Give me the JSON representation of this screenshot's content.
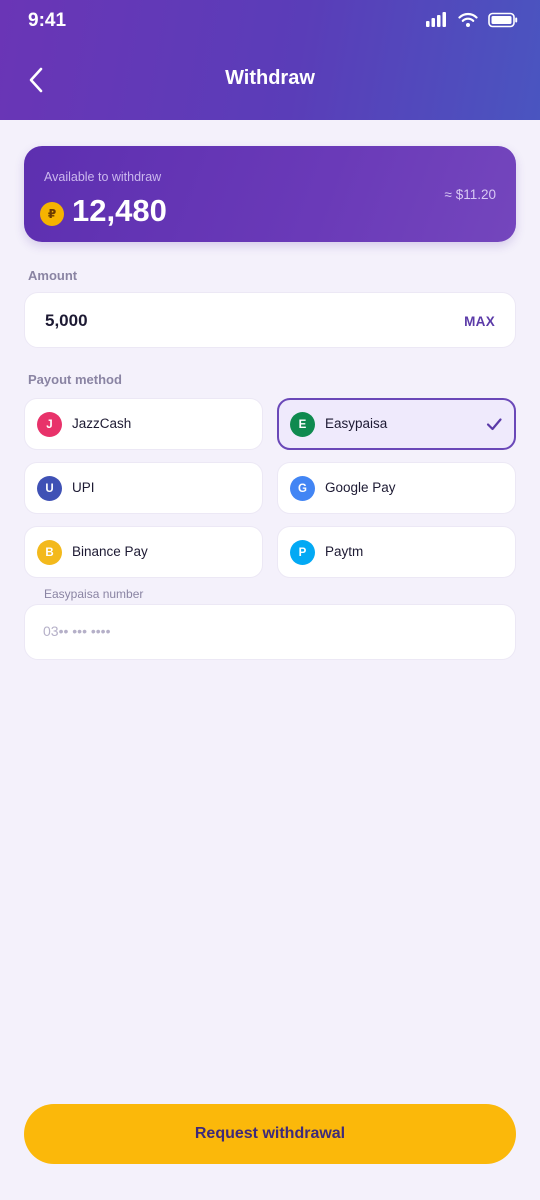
{
  "status_bar": {
    "time": "9:41"
  },
  "header": {
    "title": "Withdraw"
  },
  "balance": {
    "label": "Available to withdraw",
    "coin_symbol": "₽",
    "value": "12,480",
    "usd_equivalent": "≈ $11.20"
  },
  "amount": {
    "label": "Amount",
    "value": "5,000",
    "max_label": "MAX"
  },
  "payout": {
    "label": "Payout method",
    "selected": "Easypaisa",
    "methods": [
      {
        "initial": "J",
        "name": "JazzCash",
        "color": "#e8326a"
      },
      {
        "initial": "E",
        "name": "Easypaisa",
        "color": "#0f8a4f"
      },
      {
        "initial": "U",
        "name": "UPI",
        "color": "#3f51b5"
      },
      {
        "initial": "G",
        "name": "Google Pay",
        "color": "#4285f4"
      },
      {
        "initial": "B",
        "name": "Binance Pay",
        "color": "#f3b91c"
      },
      {
        "initial": "P",
        "name": "Paytm",
        "color": "#03a9f4"
      }
    ]
  },
  "number_field": {
    "label": "Easypaisa number",
    "placeholder": "03•• ••• ••••"
  },
  "cta": {
    "label": "Request withdrawal"
  },
  "colors": {
    "accent": "#5b3aa8",
    "cta": "#fbb80a",
    "background": "#f4f1fb"
  },
  "icons": [
    "signal-icon",
    "wifi-icon",
    "battery-icon",
    "back-chevron-icon",
    "coin-icon",
    "checkmark-icon"
  ]
}
